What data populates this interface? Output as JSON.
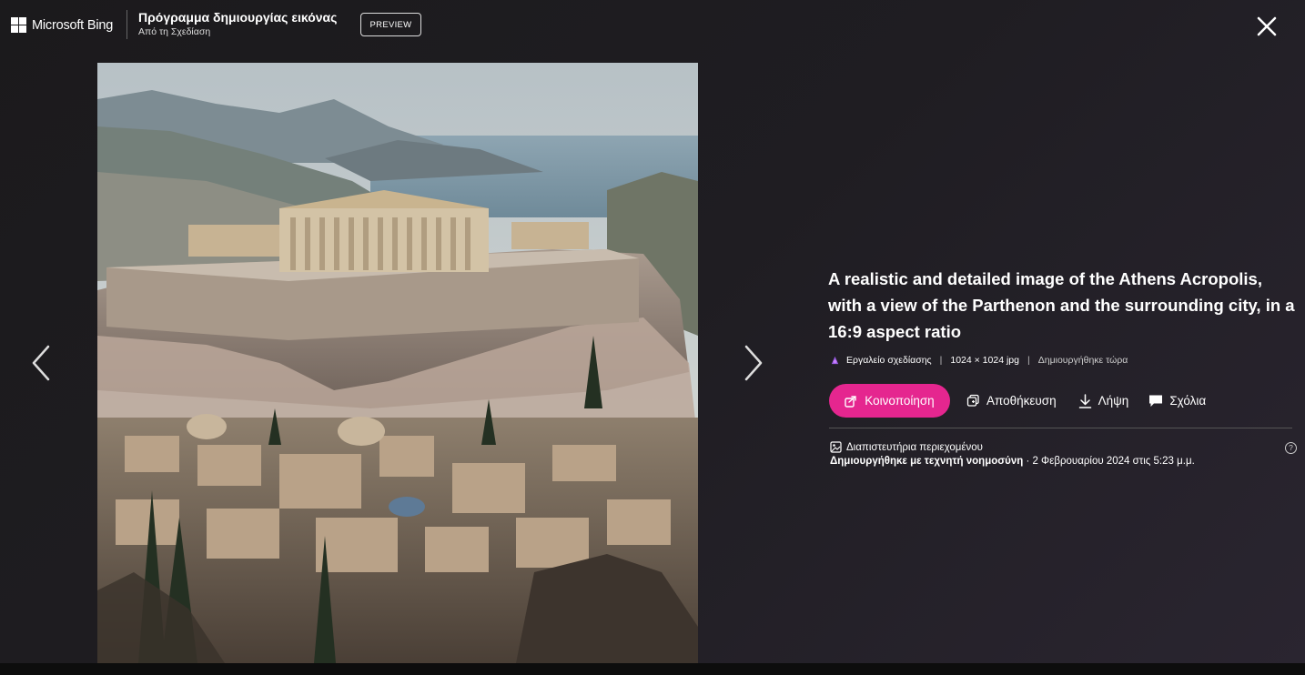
{
  "header": {
    "brand": "Microsoft Bing",
    "title": "Πρόγραμμα δημιουργίας εικόνας",
    "subtitle": "Από τη Σχεδίαση",
    "preview_label": "PREVIEW"
  },
  "image": {
    "description": "A realistic and detailed image of the Athens Acropolis, with a view of the Parthenon and the surrounding city, in a 16:9 aspect ratio"
  },
  "meta": {
    "tool": "Εργαλείο σχεδίασης",
    "dimensions": "1024 × 1024 jpg",
    "created": "Δημιουργήθηκε τώρα"
  },
  "actions": {
    "share": "Κοινοποίηση",
    "save": "Αποθήκευση",
    "download": "Λήψη",
    "comments": "Σχόλια"
  },
  "credentials": {
    "title": "Διαπιστευτήρια περιεχομένου",
    "ai_label": "Δημιουργήθηκε με τεχνητή νοημοσύνη",
    "date": " · 2 Φεβρουαρίου 2024 στις 5:23 μ.μ.",
    "help_glyph": "?"
  },
  "colors": {
    "accent": "#e5268f",
    "background": "#1e1c20"
  }
}
